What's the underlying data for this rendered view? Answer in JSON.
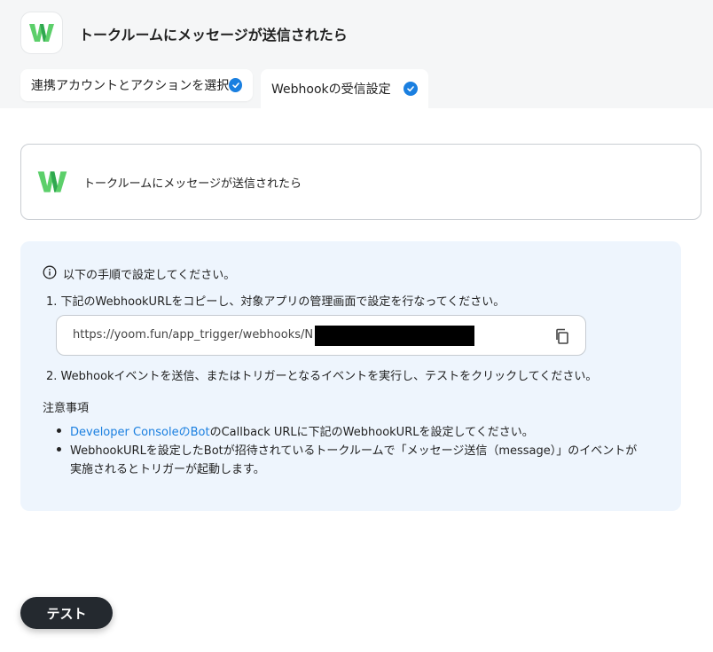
{
  "header": {
    "title": "トークルームにメッセージが送信されたら",
    "app_icon": "chatwork-w-logo"
  },
  "tabs": [
    {
      "label": "連携アカウントとアクションを選択",
      "completed": true
    },
    {
      "label": "Webhookの受信設定",
      "completed": true,
      "active": true
    }
  ],
  "trigger": {
    "label": "トークルームにメッセージが送信されたら",
    "icon": "chatwork-w-logo"
  },
  "instructions": {
    "intro": "以下の手順で設定してください。",
    "step1": "1. 下記のWebhookURLをコピーし、対象アプリの管理画面で設定を行なってください。",
    "webhook_url": "https://yoom.fun/app_trigger/webhooks/N",
    "step2": "2. Webhookイベントを送信、またはトリガーとなるイベントを実行し、テストをクリックしてください。",
    "notes_title": "注意事項",
    "note1_link": "Developer ConsoleのBot",
    "note1_rest": "のCallback URLに下記のWebhookURLを設定してください。",
    "note2_line1": "WebhookURLを設定したBotが招待されているトークルームで「メッセージ送信（message）」のイベントが",
    "note2_line2": "実施されるとトリガーが起動します。"
  },
  "actions": {
    "test_label": "テスト"
  },
  "colors": {
    "accent": "#1a7fe0",
    "info_bg": "#eef5fd",
    "button_bg": "#24292f"
  }
}
